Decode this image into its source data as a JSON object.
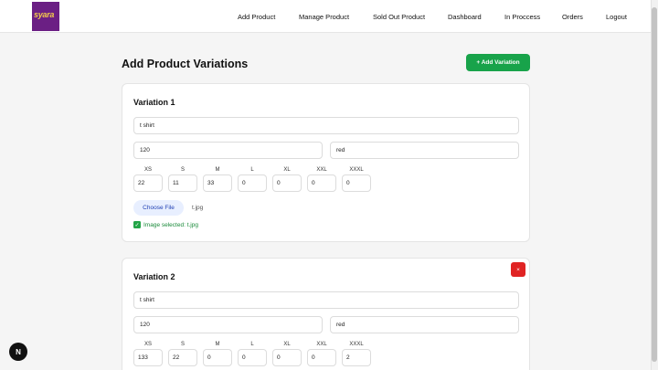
{
  "brand": {
    "logo_text": "syara",
    "logo_color": "#6b1f84"
  },
  "nav": {
    "items": [
      "Add Product",
      "Manage Product",
      "Sold Out Product",
      "Dashboard",
      "In Proccess",
      "Orders",
      "Logout"
    ]
  },
  "page": {
    "title": "Add Product Variations",
    "add_button": "+ Add Variation"
  },
  "sizes": [
    "XS",
    "S",
    "M",
    "L",
    "XL",
    "XXL",
    "XXXL"
  ],
  "variations": [
    {
      "title": "Variation 1",
      "name": "t shirt",
      "price": "120",
      "color": "red",
      "quantities": [
        "22",
        "11",
        "33",
        "0",
        "0",
        "0",
        "0"
      ],
      "file_button": "Choose File",
      "file_name": "t.jpg",
      "image_selected": "Image selected: t.jpg"
    },
    {
      "title": "Variation 2",
      "name": "t shirt",
      "price": "120",
      "color": "red",
      "quantities": [
        "133",
        "22",
        "0",
        "0",
        "0",
        "0",
        "2"
      ],
      "remove_label": "×"
    }
  ],
  "devtools": {
    "badge": "N"
  },
  "colors": {
    "accent_green": "#18a34a",
    "danger_red": "#e02424",
    "file_button_text": "#1f3fb3"
  }
}
